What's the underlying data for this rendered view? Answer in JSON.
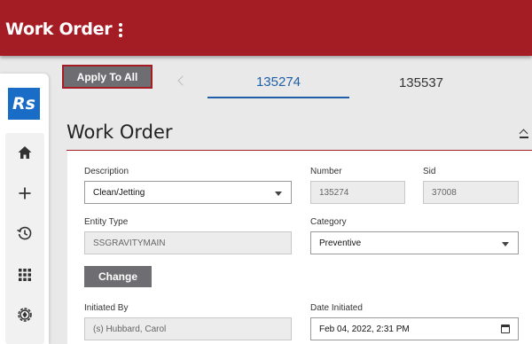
{
  "header": {
    "title": "Work Order",
    "menu_icon": "kebab-menu-icon"
  },
  "sidebar": {
    "logo": "Rs",
    "items": [
      {
        "name": "home",
        "icon": "home-icon"
      },
      {
        "name": "add",
        "icon": "plus-icon"
      },
      {
        "name": "history",
        "icon": "history-icon"
      },
      {
        "name": "apps",
        "icon": "grid-icon"
      },
      {
        "name": "settings",
        "icon": "gear-icon"
      }
    ]
  },
  "toolbar": {
    "apply_label": "Apply To All"
  },
  "tabs": [
    {
      "label": "135274",
      "active": true
    },
    {
      "label": "135537",
      "active": false
    }
  ],
  "section": {
    "title": "Work Order"
  },
  "form": {
    "description": {
      "label": "Description",
      "value": "Clean/Jetting"
    },
    "number": {
      "label": "Number",
      "value": "135274"
    },
    "sid": {
      "label": "Sid",
      "value": "37008"
    },
    "entity_type": {
      "label": "Entity Type",
      "value": "SSGRAVITYMAIN"
    },
    "category": {
      "label": "Category",
      "value": "Preventive"
    },
    "change_label": "Change",
    "initiated_by": {
      "label": "Initiated By",
      "value": "(s) Hubbard, Carol"
    },
    "date_initiated": {
      "label": "Date Initiated",
      "value": "Feb 04, 2022, 2:31 PM"
    }
  },
  "colors": {
    "brand": "#a51d24",
    "accent": "#1f5fa8",
    "button_gray": "#6e6e72",
    "logo_blue": "#1a6dc6"
  }
}
